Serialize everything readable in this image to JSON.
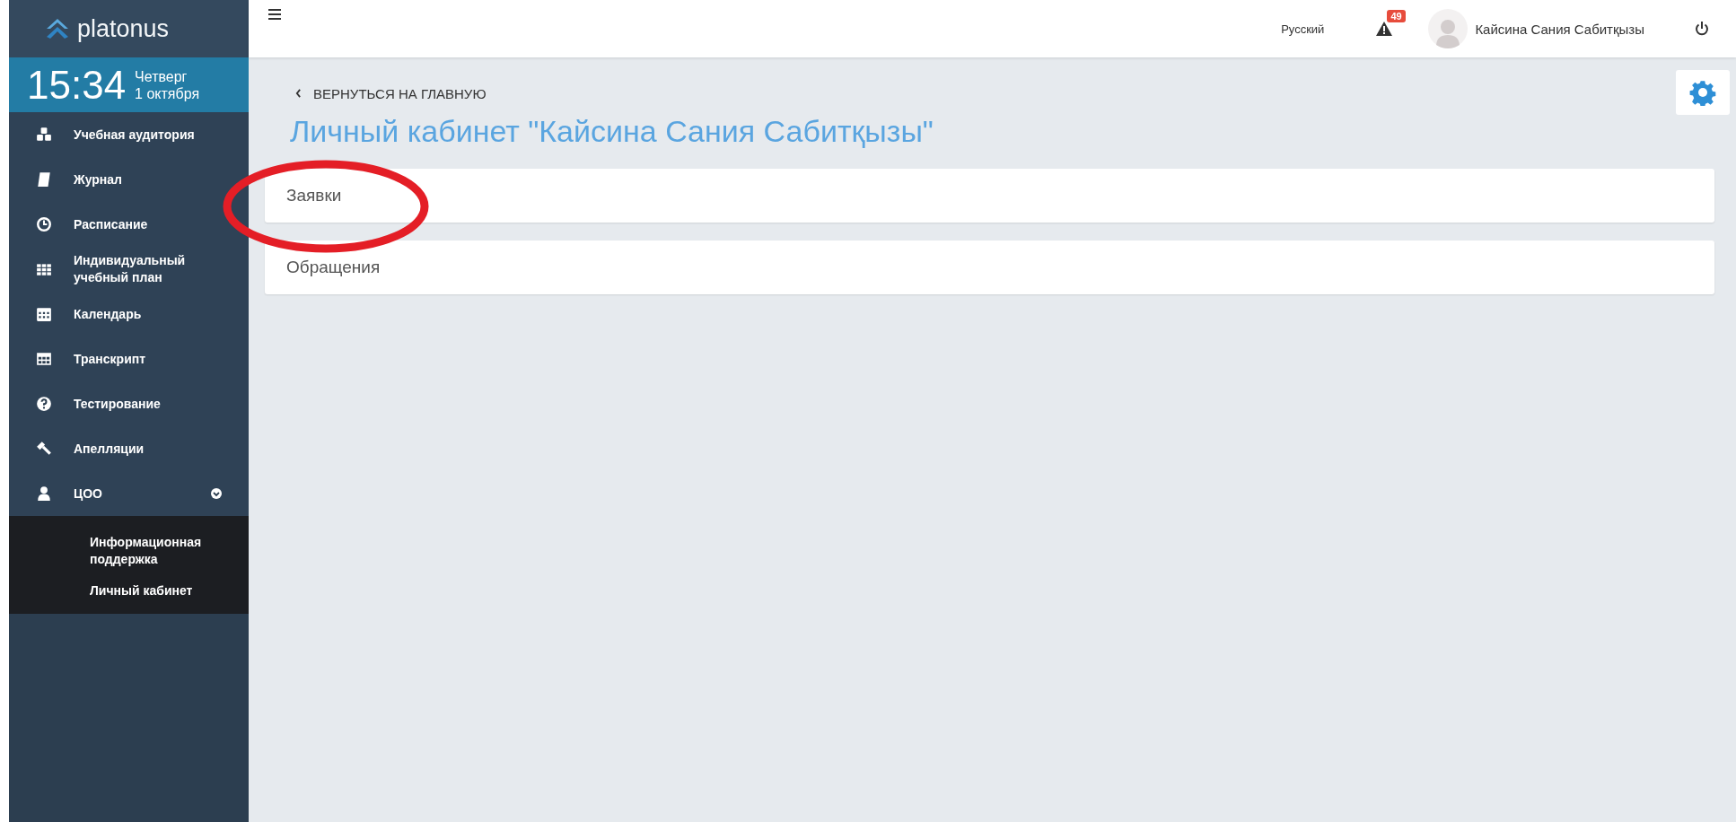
{
  "logo": {
    "text": "platonus"
  },
  "clock": {
    "time": "15:34",
    "weekday": "Четверг",
    "date": "1 октября"
  },
  "sidebar": {
    "items": [
      {
        "label": "Учебная аудитория"
      },
      {
        "label": "Журнал"
      },
      {
        "label": "Расписание"
      },
      {
        "label": "Индивидуальный учебный план"
      },
      {
        "label": "Календарь"
      },
      {
        "label": "Транскрипт"
      },
      {
        "label": "Тестирование"
      },
      {
        "label": "Апелляции"
      },
      {
        "label": "ЦОО",
        "expanded": true,
        "children": [
          {
            "label": "Информационная поддержка"
          },
          {
            "label": "Личный кабинет"
          }
        ]
      }
    ]
  },
  "header": {
    "language": "Русский",
    "alerts_badge": "49",
    "user_name": "Кайсина Сания Сабитқызы"
  },
  "back_link": "ВЕРНУТЬСЯ НА ГЛАВНУЮ",
  "page_title": "Личный кабинет \"Кайсина Сания Сабитқызы\"",
  "panels": [
    {
      "title": "Заявки"
    },
    {
      "title": "Обращения"
    }
  ]
}
